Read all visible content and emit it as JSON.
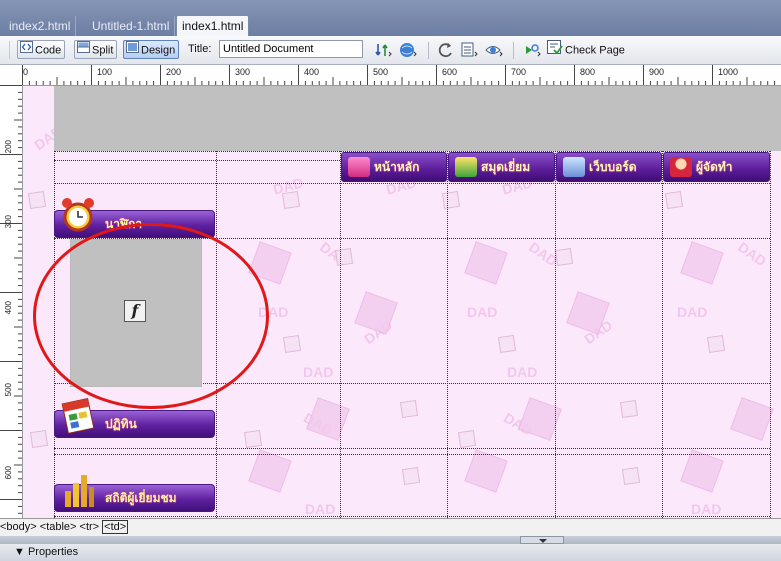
{
  "tabs": [
    {
      "label": "index2.html",
      "active": false
    },
    {
      "label": "Untitled-1.html",
      "active": false
    },
    {
      "label": "index1.html",
      "active": true
    }
  ],
  "toolbar": {
    "code_label": "Code",
    "split_label": "Split",
    "design_label": "Design",
    "title_label": "Title:",
    "title_value": "Untitled Document",
    "check_page_label": "Check Page"
  },
  "ruler": {
    "h_ticks": [
      "0",
      "100",
      "200",
      "300",
      "400",
      "500",
      "600",
      "700",
      "800",
      "900",
      "1000"
    ],
    "v_ticks": [
      "200",
      "300",
      "400",
      "500",
      "600"
    ]
  },
  "page": {
    "nav": [
      "หน้าหลัก",
      "สมุดเยี่ยม",
      "เว็บบอร์ด",
      "ผู้จัดทำ"
    ],
    "side": [
      "นาฬิกา",
      "ปฏิทิน",
      "สถิติผู้เยี่ยมชม"
    ],
    "watermark": "DAD"
  },
  "tagbar": {
    "body": "<body>",
    "table": "<table>",
    "tr": "<tr>",
    "td": "<td>"
  },
  "properties_label": "▼ Properties",
  "colors": {
    "accent_purple": "#5b1c98",
    "canvas_bg": "#fce8fb",
    "highlight": "#e01818"
  }
}
